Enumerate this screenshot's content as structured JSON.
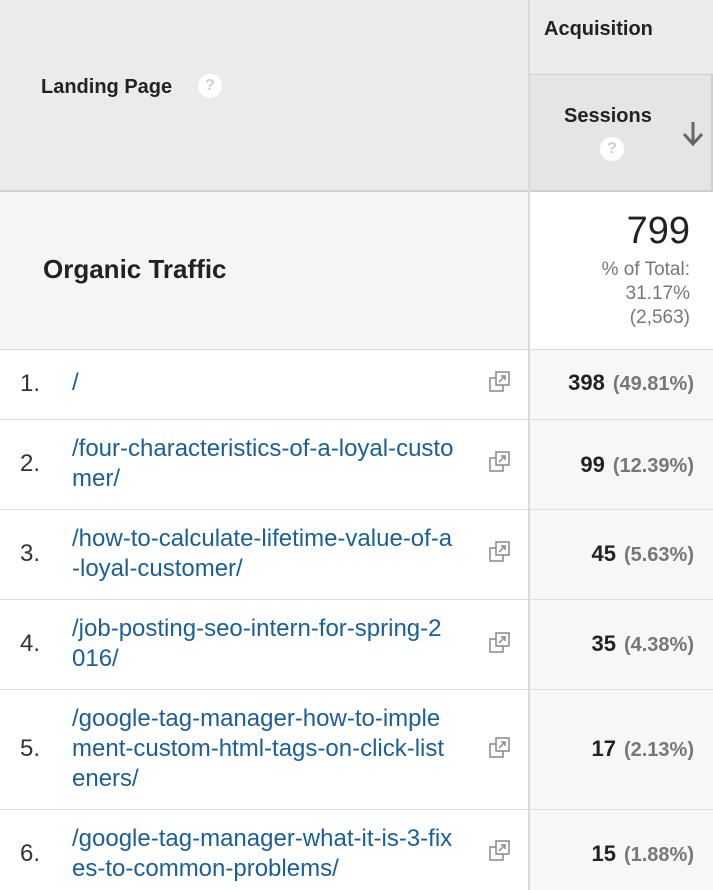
{
  "header": {
    "landing_page_label": "Landing Page",
    "help_glyph": "?",
    "group_label": "Acquisition",
    "sessions_label": "Sessions",
    "sort": "descending"
  },
  "summary": {
    "label": "Organic Traffic",
    "value": "799",
    "pct_label": "% of Total:",
    "pct_value": "31.17%",
    "total": "(2,563)"
  },
  "rows": [
    {
      "rank": "1.",
      "page_line1": "/",
      "page_line2": "",
      "page_line3": "",
      "sessions": "398",
      "pct": "(49.81%)"
    },
    {
      "rank": "2.",
      "page_line1": "/four-characteristics-of-a-loyal-custo",
      "page_line2": "mer/",
      "page_line3": "",
      "sessions": "99",
      "pct": "(12.39%)"
    },
    {
      "rank": "3.",
      "page_line1": "/how-to-calculate-lifetime-value-of-a",
      "page_line2": "-loyal-customer/",
      "page_line3": "",
      "sessions": "45",
      "pct": "(5.63%)"
    },
    {
      "rank": "4.",
      "page_line1": "/job-posting-seo-intern-for-spring-2",
      "page_line2": "016/",
      "page_line3": "",
      "sessions": "35",
      "pct": "(4.38%)"
    },
    {
      "rank": "5.",
      "page_line1": "/google-tag-manager-how-to-imple",
      "page_line2": "ment-custom-html-tags-on-click-list",
      "page_line3": "eners/",
      "sessions": "17",
      "pct": "(2.13%)"
    },
    {
      "rank": "6.",
      "page_line1": "/google-tag-manager-what-it-is-3-fix",
      "page_line2": "es-to-common-problems/",
      "page_line3": "",
      "sessions": "15",
      "pct": "(1.88%)"
    }
  ],
  "colors": {
    "link": "#1a5f98",
    "header_bg": "#ebebeb",
    "muted_text": "#777777"
  }
}
